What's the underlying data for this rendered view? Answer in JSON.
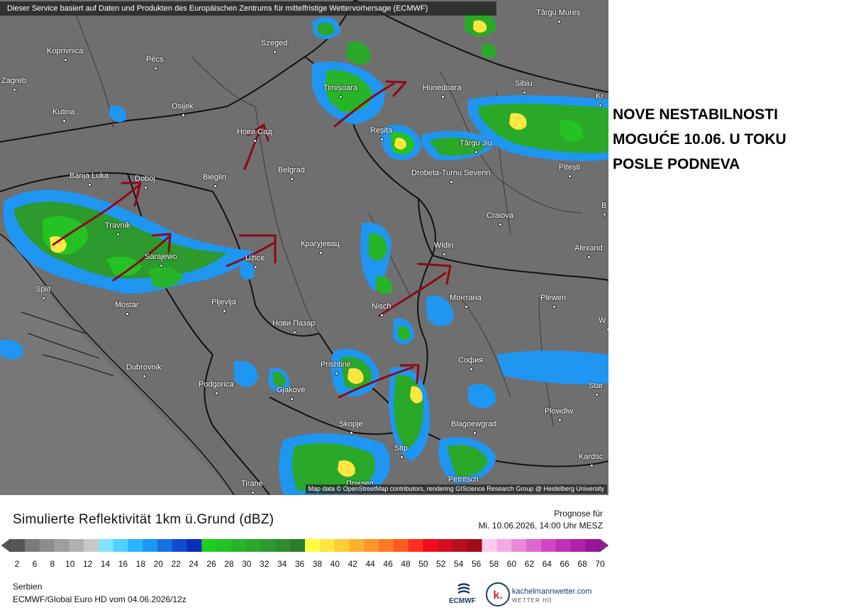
{
  "header": {
    "banner": "Dieser Service basiert auf Daten und Produkten des Europäischen Zentrums für mittelfristige Wettervorhersage (ECMWF)"
  },
  "map": {
    "attribution": "Map data © OpenStreetMap contributors, rendering GIScience Research Group @ Heidelberg University",
    "cities": [
      "Koprivnica",
      "Pécs",
      "Szeged",
      "Zagreb",
      "Kutina",
      "Osijek",
      "Timișoara",
      "Hunedoara",
      "Sibiu",
      "Reșița",
      "Târgu Jiu",
      "Pitești",
      "Нови Сад",
      "Banja Luka",
      "Doboj",
      "Bieglin",
      "Belgrad",
      "Drobeta-Turnu Severin",
      "Craiova",
      "Travnik",
      "Sarajewo",
      "Užice",
      "Крагујевац",
      "Widin",
      "Alexand",
      "Split",
      "Mostar",
      "Pljevlja",
      "Nisch",
      "Монтана",
      "Plewen",
      "Нови Пазар",
      "Dubrovnik",
      "Prishtinë",
      "София",
      "Podgorica",
      "Gjakovë",
      "Skopje",
      "Plowdiw",
      "Blagoewgrad",
      "Stip",
      "Tirane",
      "Прилеп",
      "Petritsch",
      "Târgu Mureș",
      "Kr",
      "B",
      "Star",
      "Kardsc",
      "W Ta"
    ]
  },
  "annotation": {
    "lines": [
      "NOVE NESTABILNOSTI",
      "MOGUĆE 10.06. U TOKU",
      "POSLE PODNEVA"
    ]
  },
  "legend": {
    "title": "Simulierte Reflektivität 1km ü.Grund (dBZ)",
    "forecast_label": "Prognose für",
    "forecast_time": "Mi. 10.06.2026, 14:00 Uhr MESZ",
    "ticks": [
      "2",
      "6",
      "8",
      "10",
      "12",
      "14",
      "16",
      "18",
      "20",
      "22",
      "24",
      "26",
      "28",
      "30",
      "32",
      "34",
      "36",
      "38",
      "40",
      "42",
      "44",
      "46",
      "48",
      "50",
      "52",
      "54",
      "56",
      "58",
      "60",
      "62",
      "64",
      "66",
      "68",
      "70"
    ],
    "colors": [
      "#555555",
      "#7a7a7a",
      "#8c8c8c",
      "#9e9e9e",
      "#b0b0b0",
      "#c8c8c8",
      "#7fe4ff",
      "#4fd0ff",
      "#29b6ff",
      "#1f96f2",
      "#1670e0",
      "#0f4bd0",
      "#0a2db8",
      "#1ed01e",
      "#24c224",
      "#28b428",
      "#2aa82a",
      "#2c9a2c",
      "#2e8c2e",
      "#2a7e2a",
      "#ffff40",
      "#ffe640",
      "#ffcc33",
      "#ffb02e",
      "#ff962a",
      "#ff7a26",
      "#ff5a22",
      "#ff3020",
      "#f00e1e",
      "#d4101e",
      "#b80f1c",
      "#a00c1a",
      "#ffccee",
      "#f5a8e6",
      "#ea88dc",
      "#de68d2",
      "#d048c6",
      "#c030b8",
      "#ad22a8",
      "#9a1698"
    ],
    "region": "Serbien",
    "model": "ECMWF/Global Euro HD vom  04.06.2026/12z"
  },
  "logos": {
    "ecmwf": "ECMWF",
    "kachelmann": "kachelmannwetter.com",
    "kachelmann_sub": "WETTER HD",
    "kachelmann_letter": "k."
  }
}
